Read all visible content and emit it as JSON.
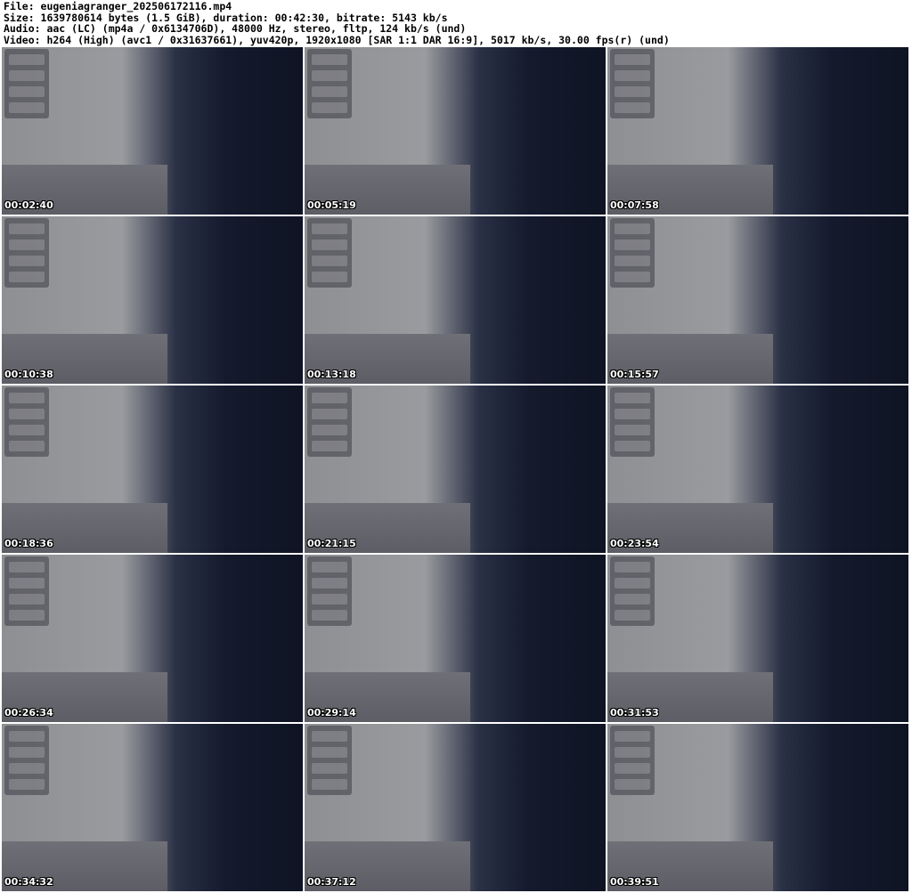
{
  "header": {
    "file": "File: eugeniagranger_202506172116.mp4",
    "size": "Size: 1639780614 bytes (1.5 GiB), duration: 00:42:30, bitrate: 5143 kb/s",
    "audio": "Audio: aac (LC) (mp4a / 0x6134706D), 48000 Hz, stereo, fltp, 124 kb/s (und)",
    "video": "Video: h264 (High) (avc1 / 0x31637661), yuv420p, 1920x1080 [SAR 1:1 DAR 16:9], 5017 kb/s, 30.00 fps(r) (und)"
  },
  "frames": [
    {
      "timestamp": "00:02:40"
    },
    {
      "timestamp": "00:05:19"
    },
    {
      "timestamp": "00:07:58"
    },
    {
      "timestamp": "00:10:38"
    },
    {
      "timestamp": "00:13:18"
    },
    {
      "timestamp": "00:15:57"
    },
    {
      "timestamp": "00:18:36"
    },
    {
      "timestamp": "00:21:15"
    },
    {
      "timestamp": "00:23:54"
    },
    {
      "timestamp": "00:26:34"
    },
    {
      "timestamp": "00:29:14"
    },
    {
      "timestamp": "00:31:53"
    },
    {
      "timestamp": "00:34:32"
    },
    {
      "timestamp": "00:37:12"
    },
    {
      "timestamp": "00:39:51"
    }
  ]
}
